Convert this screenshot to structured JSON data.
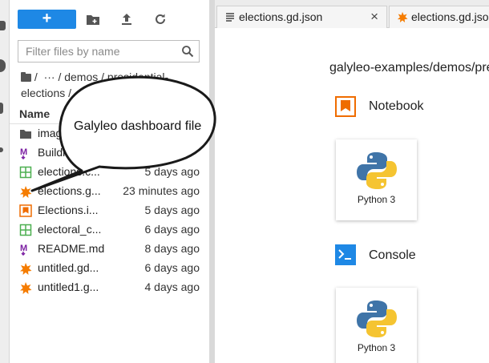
{
  "toolbar": {
    "new_label": "+",
    "icons": [
      "new-folder-icon",
      "upload-icon",
      "refresh-icon"
    ]
  },
  "search": {
    "placeholder": "Filter files by name",
    "value": ""
  },
  "breadcrumb": {
    "root_icon": "folder-icon",
    "sep1": "/",
    "ellipsis": "···",
    "sep2": "/ demos /",
    "current": "presidential-elections",
    "line1_tail": " presidential-",
    "line2": "elections /"
  },
  "file_list": {
    "header_name": "Name",
    "rows": [
      {
        "icon": "folder-icon",
        "name": "images",
        "modified": ""
      },
      {
        "icon": "markdown-icon",
        "name": "Building...",
        "modified": ""
      },
      {
        "icon": "spreadsheet-icon",
        "name": "elections.c...",
        "modified": "5 days ago"
      },
      {
        "icon": "galyleo-icon",
        "name": "elections.g...",
        "modified": "23 minutes ago"
      },
      {
        "icon": "notebook-icon",
        "name": "Elections.i...",
        "modified": "5 days ago"
      },
      {
        "icon": "spreadsheet-icon",
        "name": "electoral_c...",
        "modified": "6 days ago"
      },
      {
        "icon": "markdown-icon",
        "name": "README.md",
        "modified": "8 days ago"
      },
      {
        "icon": "galyleo-icon",
        "name": "untitled.gd...",
        "modified": "6 days ago"
      },
      {
        "icon": "galyleo-icon",
        "name": "untitled1.g...",
        "modified": "4 days ago"
      }
    ]
  },
  "callout": {
    "text": "Galyleo dashboard file"
  },
  "tabs": [
    {
      "icon": "text-file-icon",
      "label": "elections.gd.json",
      "close": "×"
    },
    {
      "icon": "galyleo-icon",
      "label": "elections.gd.json"
    }
  ],
  "launcher": {
    "path": "galyleo-examples/demos/pre",
    "sections": [
      {
        "icon": "notebook-icon",
        "title": "Notebook",
        "cards": [
          {
            "icon": "python-icon",
            "label": "Python 3"
          }
        ]
      },
      {
        "icon": "console-icon",
        "title": "Console",
        "cards": [
          {
            "icon": "python-icon",
            "label": "Python 3"
          }
        ]
      }
    ]
  },
  "colors": {
    "accent_blue": "#1e88e5",
    "galyleo_orange": "#f57c00",
    "notebook_orange": "#ef6c00",
    "spreadsheet_green": "#4caf50",
    "markdown_purple": "#7b1fa2",
    "console_blue": "#1e88e5"
  }
}
